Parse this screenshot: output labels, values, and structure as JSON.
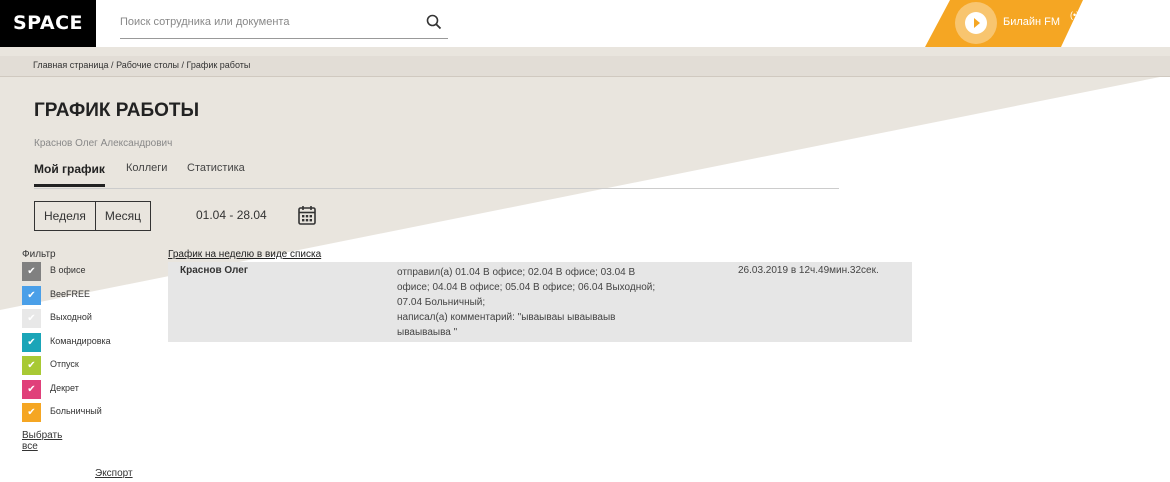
{
  "header": {
    "logo": "SPACE",
    "search_placeholder": "Поиск сотрудника или документа",
    "radio_label": "Билайн FM",
    "radio_signal": "(•)"
  },
  "breadcrumb": [
    "Главная страница",
    "Рабочие столы",
    "График работы"
  ],
  "breadcrumb_separator": " / ",
  "page_title": "ГРАФИК РАБОТЫ",
  "user_name": "Краснов Олег Александрович",
  "tabs": [
    {
      "label": "Мой график",
      "active": true
    },
    {
      "label": "Коллеги",
      "active": false
    },
    {
      "label": "Статистика",
      "active": false
    }
  ],
  "period_buttons": [
    "Неделя",
    "Месяц"
  ],
  "date_range": "01.04 - 28.04",
  "filter": {
    "title": "Фильтр",
    "items": [
      {
        "label": "В офисе",
        "color": "#808080"
      },
      {
        "label": "BeeFREE",
        "color": "#4a9fe8"
      },
      {
        "label": "Выходной",
        "color": "#e8e8e8"
      },
      {
        "label": "Командировка",
        "color": "#1aa5b8"
      },
      {
        "label": "Отпуск",
        "color": "#a8c934"
      },
      {
        "label": "Декрет",
        "color": "#e0407a"
      },
      {
        "label": "Больничный",
        "color": "#f5a623"
      }
    ],
    "select_all": "Выбрать все",
    "checkmark": "✔"
  },
  "export_label": "Экспорт",
  "list_link": "График на неделю в виде списка",
  "rows": [
    {
      "name": "Краснов Олег",
      "lines": [
        "отправил(а) 01.04 В офисе; 02.04 В офисе; 03.04 В",
        "офисе; 04.04 В офисе; 05.04 В офисе; 06.04 Выходной;",
        "07.04 Больничный;",
        "написал(а) комментарий: \"ываываы ываываыв",
        "ываываыва \""
      ],
      "timestamp": "26.03.2019 в 12ч.49мин.32сек."
    }
  ],
  "colors": {
    "accent": "#f5a623",
    "beige": "#e9e5de",
    "breadcrumb_bg": "#e2ddd6"
  }
}
